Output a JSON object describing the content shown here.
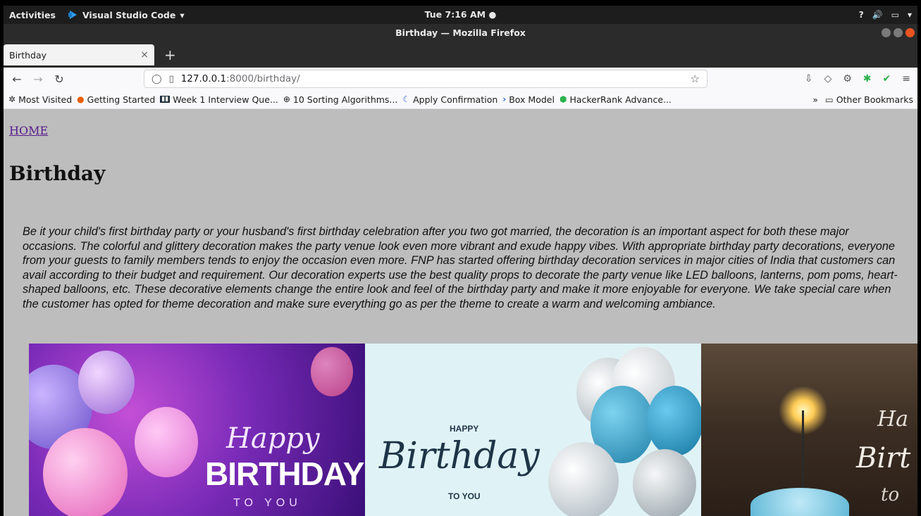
{
  "system": {
    "activities": "Activities",
    "app_name": "Visual Studio Code",
    "clock": "Tue  7:16 AM",
    "tray_question": "?"
  },
  "window": {
    "title": "Birthday — Mozilla Firefox"
  },
  "tabs": [
    {
      "label": "Birthday",
      "close": "×"
    }
  ],
  "new_tab": "+",
  "navbar": {
    "url_host": "127.0.0.1",
    "url_path": ":8000/birthday/"
  },
  "bookmarks": {
    "items": [
      {
        "label": "Most Visited",
        "icon": "gear-icon"
      },
      {
        "label": "Getting Started",
        "icon": "firefox-icon"
      },
      {
        "label": "Week 1 Interview Que...",
        "icon": "interview-icon"
      },
      {
        "label": "10 Sorting Algorithms...",
        "icon": "globe-icon"
      },
      {
        "label": "Apply Confirmation",
        "icon": "moon-icon"
      },
      {
        "label": "Box Model",
        "icon": "terminal-icon"
      },
      {
        "label": "HackerRank Advance...",
        "icon": "hackerrank-icon"
      }
    ],
    "overflow": "»",
    "other": "Other Bookmarks"
  },
  "page": {
    "home_link": "HOME",
    "heading": "Birthday",
    "paragraph": "Be it your child's first birthday party or your husband's first birthday celebration after you two got married, the decoration is an important aspect for both these major occasions. The colorful and glittery decoration makes the party venue look even more vibrant and exude happy vibes. With appropriate birthday party decorations, everyone from your guests to family members tends to enjoy the occasion even more. FNP has started offering birthday decoration services in major cities of India that customers can avail according to their budget and requirement. Our decoration experts use the best quality props to decorate the party venue like LED balloons, lanterns, pom poms, heart-shaped balloons, etc. These decorative elements change the entire look and feel of the birthday party and make it more enjoyable for everyone. We take special care when the customer has opted for theme decoration and make sure everything go as per the theme to create a warm and welcoming ambiance.",
    "images": [
      {
        "line1": "Happy",
        "line2": "BIRTHDAY",
        "line3": "TO YOU"
      },
      {
        "line1": "HAPPY",
        "line2": "Birthday",
        "line3": "TO YOU"
      },
      {
        "line1": "Ha",
        "line2": "Birt",
        "line3": "to"
      }
    ]
  },
  "colors": {
    "page_bg": "#bdbdbd",
    "link": "#551a8b",
    "topbar": "#1d1d1d"
  }
}
